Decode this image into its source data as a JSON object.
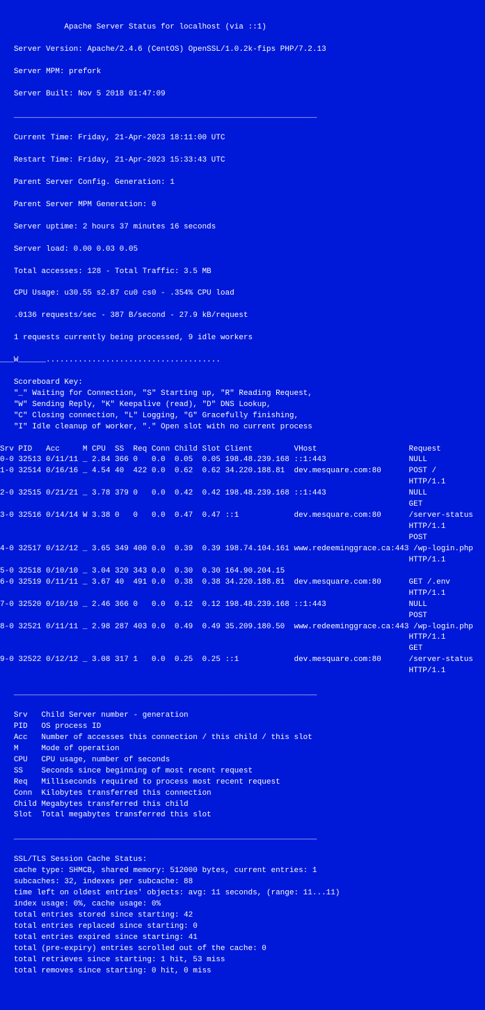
{
  "header": {
    "title": "Apache Server Status for localhost (via ::1)"
  },
  "server": {
    "version": "Server Version: Apache/2.4.6 (CentOS) OpenSSL/1.0.2k-fips PHP/7.2.13",
    "mpm": "Server MPM: prefork",
    "built": "Server Built: Nov 5 2018 01:47:09"
  },
  "hr": "   __________________________________________________________________",
  "status": {
    "current_time": "Current Time: Friday, 21-Apr-2023 18:11:00 UTC",
    "restart_time": "Restart Time: Friday, 21-Apr-2023 15:33:43 UTC",
    "config_gen": "Parent Server Config. Generation: 1",
    "mpm_gen": "Parent Server MPM Generation: 0",
    "uptime": "Server uptime: 2 hours 37 minutes 16 seconds",
    "load": "Server load: 0.00 0.03 0.05",
    "totals": "Total accesses: 128 - Total Traffic: 3.5 MB",
    "cpu": "CPU Usage: u30.55 s2.87 cu0 cs0 - .354% CPU load",
    "rate": ".0136 requests/sec - 387 B/second - 27.9 kB/request",
    "workers": "1 requests currently being processed, 9 idle workers"
  },
  "scoreboard": {
    "line": "___W______......................................",
    "key_header": "Scoreboard Key:",
    "key_1": "\"_\" Waiting for Connection, \"S\" Starting up, \"R\" Reading Request,",
    "key_2": "\"W\" Sending Reply, \"K\" Keepalive (read), \"D\" DNS Lookup,",
    "key_3": "\"C\" Closing connection, \"L\" Logging, \"G\" Gracefully finishing,",
    "key_4": "\"I\" Idle cleanup of worker, \".\" Open slot with no current process"
  },
  "table": {
    "header": "Srv PID   Acc     M CPU  SS  Req Conn Child Slot Client         VHost                    Request",
    "rows": [
      "0-0 32513 0/11/11 _ 2.84 366 0   0.0  0.05  0.05 198.48.239.168 ::1:443                  NULL",
      "1-0 32514 0/16/16 _ 4.54 40  422 0.0  0.62  0.62 34.220.188.81  dev.mesquare.com:80      POST /\n                                                                                         HTTP/1.1",
      "2-0 32515 0/21/21 _ 3.78 379 0   0.0  0.42  0.42 198.48.239.168 ::1:443                  NULL\n                                                                                         GET",
      "3-0 32516 0/14/14 W 3.38 0   0   0.0  0.47  0.47 ::1            dev.mesquare.com:80      /server-status\n                                                                                         HTTP/1.1\n                                                                                         POST",
      "4-0 32517 0/12/12 _ 3.65 349 400 0.0  0.39  0.39 198.74.104.161 www.redeeminggrace.ca:443 /wp-login.php\n                                                                                         HTTP/1.1",
      "5-0 32518 0/10/10 _ 3.04 320 343 0.0  0.30  0.30 164.90.204.15",
      "6-0 32519 0/11/11 _ 3.67 40  491 0.0  0.38  0.38 34.220.188.81  dev.mesquare.com:80      GET /.env\n                                                                                         HTTP/1.1",
      "7-0 32520 0/10/10 _ 2.46 366 0   0.0  0.12  0.12 198.48.239.168 ::1:443                  NULL\n                                                                                         POST",
      "8-0 32521 0/11/11 _ 2.98 287 403 0.0  0.49  0.49 35.209.180.50  www.redeeminggrace.ca:443 /wp-login.php\n                                                                                         HTTP/1.1\n                                                                                         GET",
      "9-0 32522 0/12/12 _ 3.08 317 1   0.0  0.25  0.25 ::1            dev.mesquare.com:80      /server-status\n                                                                                         HTTP/1.1"
    ]
  },
  "legend": {
    "srv": "Srv   Child Server number - generation",
    "pid": "PID   OS process ID",
    "acc": "Acc   Number of accesses this connection / this child / this slot",
    "m": "M     Mode of operation",
    "cpu": "CPU   CPU usage, number of seconds",
    "ss": "SS    Seconds since beginning of most recent request",
    "req": "Req   Milliseconds required to process most recent request",
    "conn": "Conn  Kilobytes transferred this connection",
    "child": "Child Megabytes transferred this child",
    "slot": "Slot  Total megabytes transferred this slot"
  },
  "ssl": {
    "header": "SSL/TLS Session Cache Status:",
    "l1": "cache type: SHMCB, shared memory: 512000 bytes, current entries: 1",
    "l2": "subcaches: 32, indexes per subcache: 88",
    "l3": "time left on oldest entries' objects: avg: 11 seconds, (range: 11...11)",
    "l4": "index usage: 0%, cache usage: 0%",
    "l5": "total entries stored since starting: 42",
    "l6": "total entries replaced since starting: 0",
    "l7": "total entries expired since starting: 41",
    "l8": "total (pre-expiry) entries scrolled out of the cache: 0",
    "l9": "total retrieves since starting: 1 hit, 53 miss",
    "l10": "total removes since starting: 0 hit, 0 miss"
  }
}
